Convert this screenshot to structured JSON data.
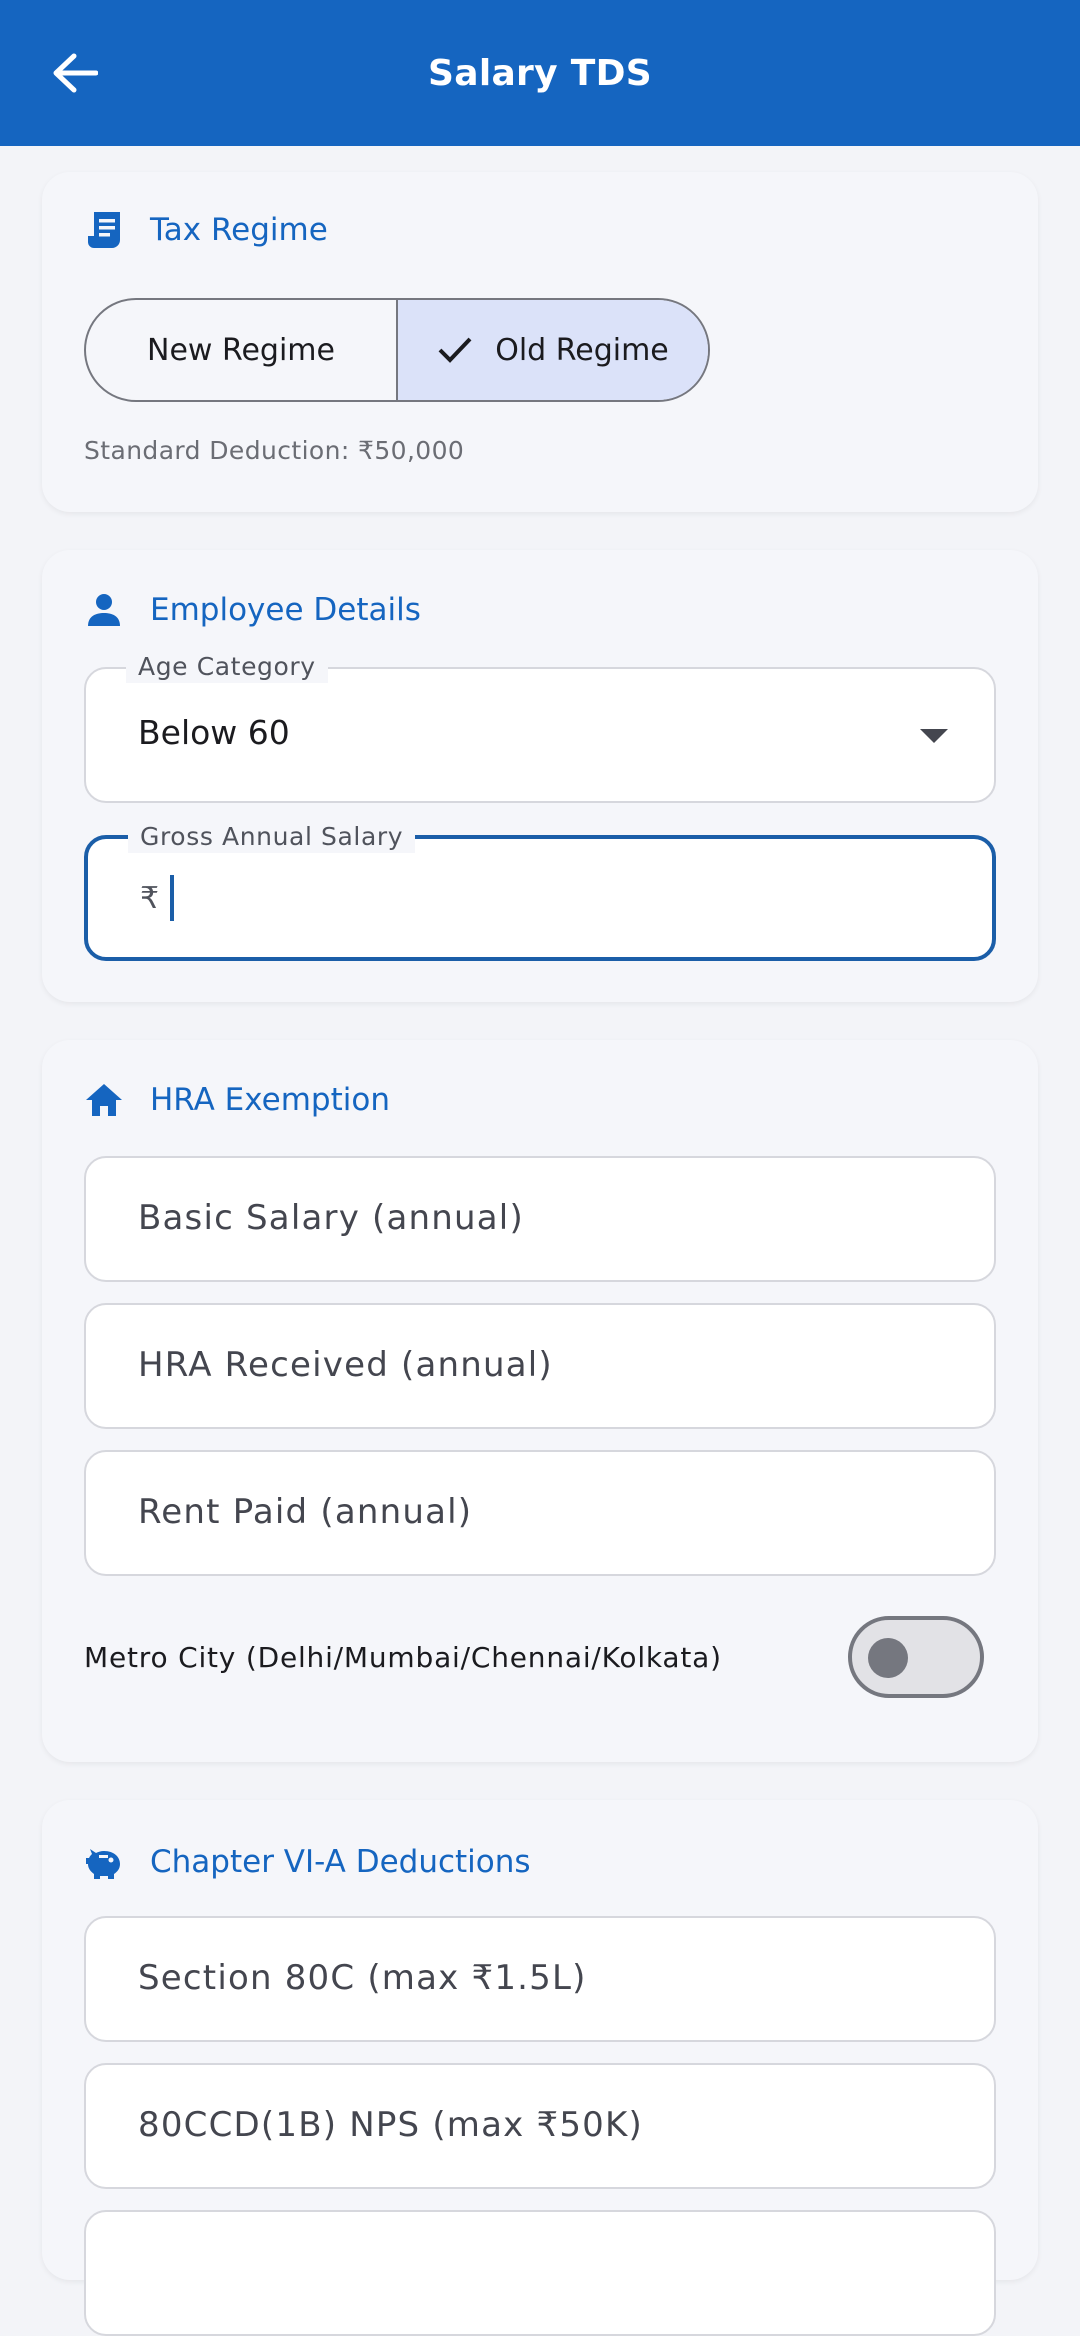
{
  "appbar": {
    "title": "Salary TDS"
  },
  "tax_regime": {
    "header": "Tax Regime",
    "options": [
      "New Regime",
      "Old Regime"
    ],
    "selected": "Old Regime",
    "note": "Standard Deduction: ₹50,000"
  },
  "employee": {
    "header": "Employee Details",
    "age_label": "Age Category",
    "age_value": "Below 60",
    "salary_label": "Gross Annual Salary",
    "currency_prefix": "₹"
  },
  "hra": {
    "header": "HRA Exemption",
    "basic_placeholder": "Basic Salary (annual)",
    "hra_placeholder": "HRA Received (annual)",
    "rent_placeholder": "Rent Paid (annual)",
    "metro_label": "Metro City (Delhi/Mumbai/Chennai/Kolkata)",
    "metro_on": false
  },
  "deductions": {
    "header": "Chapter VI-A Deductions",
    "sec80c_placeholder": "Section 80C (max ₹1.5L)",
    "nps_placeholder": "80CCD(1B) NPS (max ₹50K)"
  },
  "colors": {
    "primary": "#1565c0",
    "selected_segment": "#dbe2f9",
    "background": "#f3f4f8"
  },
  "icons": {
    "back": "arrow-left-icon",
    "tax_regime": "receipt-icon",
    "employee": "person-icon",
    "hra": "home-icon",
    "deductions": "piggy-bank-icon",
    "selected": "check-icon",
    "dropdown": "triangle-down-icon"
  }
}
